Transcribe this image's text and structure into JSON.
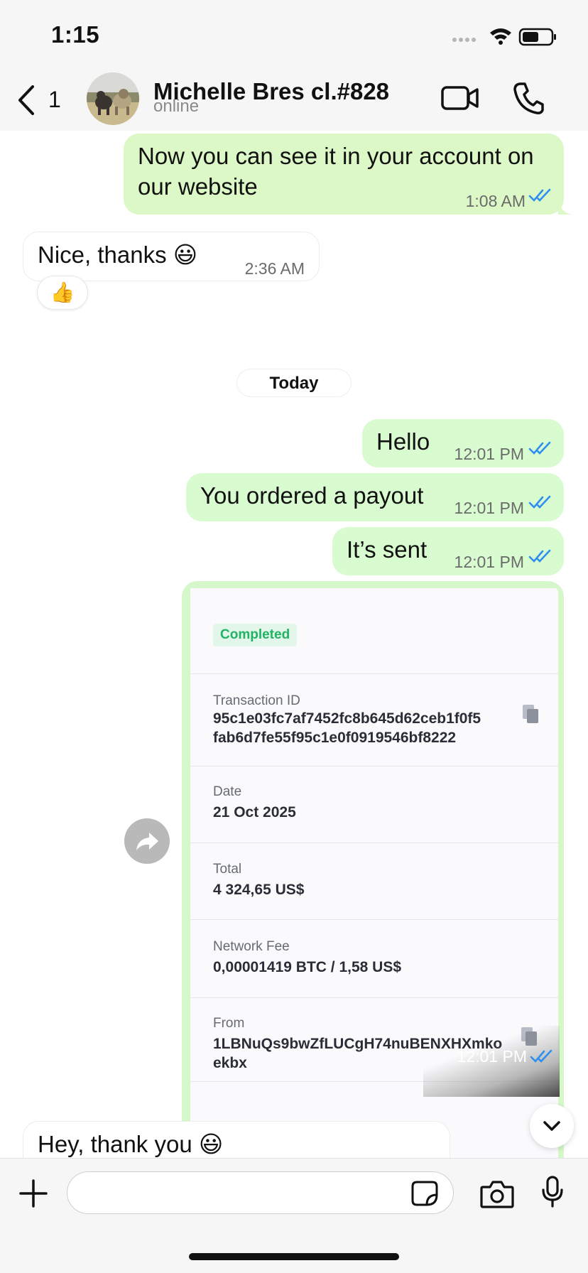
{
  "status_bar": {
    "time": "1:15"
  },
  "header": {
    "back_count": "1",
    "contact_name": "Michelle Bres cl.#828",
    "contact_status": "online"
  },
  "messages": [
    {
      "text_line1": "Now you can see it in your account on",
      "text_line2": "our website",
      "time": "1:08 AM"
    },
    {
      "text": "Nice, thanks 😃",
      "time": "2:36 AM",
      "reaction": "👍"
    },
    {
      "text": "Hello",
      "time": "12:01 PM"
    },
    {
      "text": "You ordered a payout",
      "time": "12:01 PM"
    },
    {
      "text": "It’s sent",
      "time": "12:01 PM"
    },
    {
      "text": "Hey, thank you 😃"
    }
  ],
  "day_separator": "Today",
  "transaction_card": {
    "status": "Completed",
    "transaction_id_label": "Transaction ID",
    "transaction_id_line1": "95c1e03fc7af7452fc8b645d62ceb1f0f5",
    "transaction_id_line2": "fab6d7fe55f95c1e0f0919546bf8222",
    "date_label": "Date",
    "date_value": "21 Oct 2025",
    "total_label": "Total",
    "total_value": "4 324,65 US$",
    "fee_label": "Network Fee",
    "fee_value": "0,00001419 BTC / 1,58 US$",
    "from_label": "From",
    "from_line1": "1LBNuQs9bwZfLUCgH74nuBENXHXmko",
    "from_line2": "ekbx",
    "time": "12:01 PM"
  },
  "colors": {
    "outgoing_bubble": "#dcf8c6",
    "read_ticks": "#2f8ff0",
    "completed_badge": "#20b464"
  }
}
